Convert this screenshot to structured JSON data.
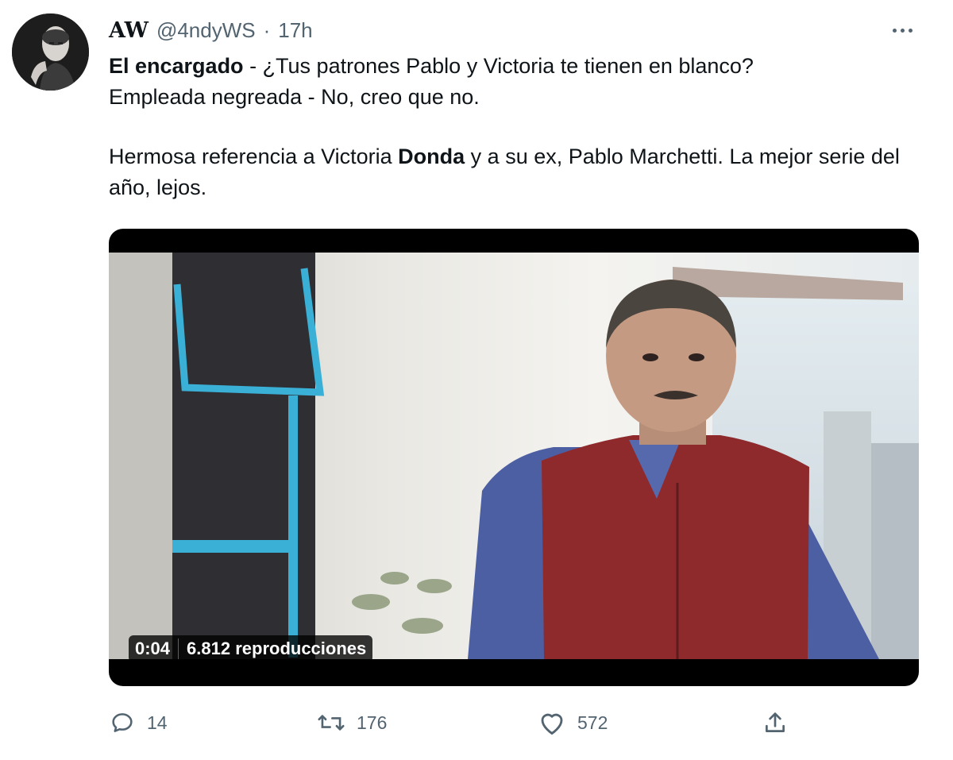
{
  "author": {
    "display_name": "AW",
    "handle": "@4ndyWS",
    "separator": "·",
    "time": "17h"
  },
  "tweet": {
    "line1_bold": "El encargado",
    "line1_rest": " - ¿Tus patrones Pablo y Victoria te tienen en blanco?",
    "line2": "Empleada negreada - No, creo que no.",
    "line3_a": "Hermosa referencia a Victoria ",
    "line3_bold": "Donda",
    "line3_b": " y a su ex, Pablo Marchetti. La mejor serie del año, lejos."
  },
  "video": {
    "duration": "0:04",
    "views": "6.812 reproducciones"
  },
  "actions": {
    "replies": "14",
    "retweets": "176",
    "likes": "572"
  },
  "icons": [
    "more-icon",
    "reply-icon",
    "retweet-icon",
    "like-icon",
    "share-icon"
  ],
  "colors": {
    "text": "#0f1419",
    "secondary": "#536471",
    "vest": "#8e2a2c",
    "shirt": "#4d5fa3",
    "window_trim": "#3bb0d6"
  }
}
